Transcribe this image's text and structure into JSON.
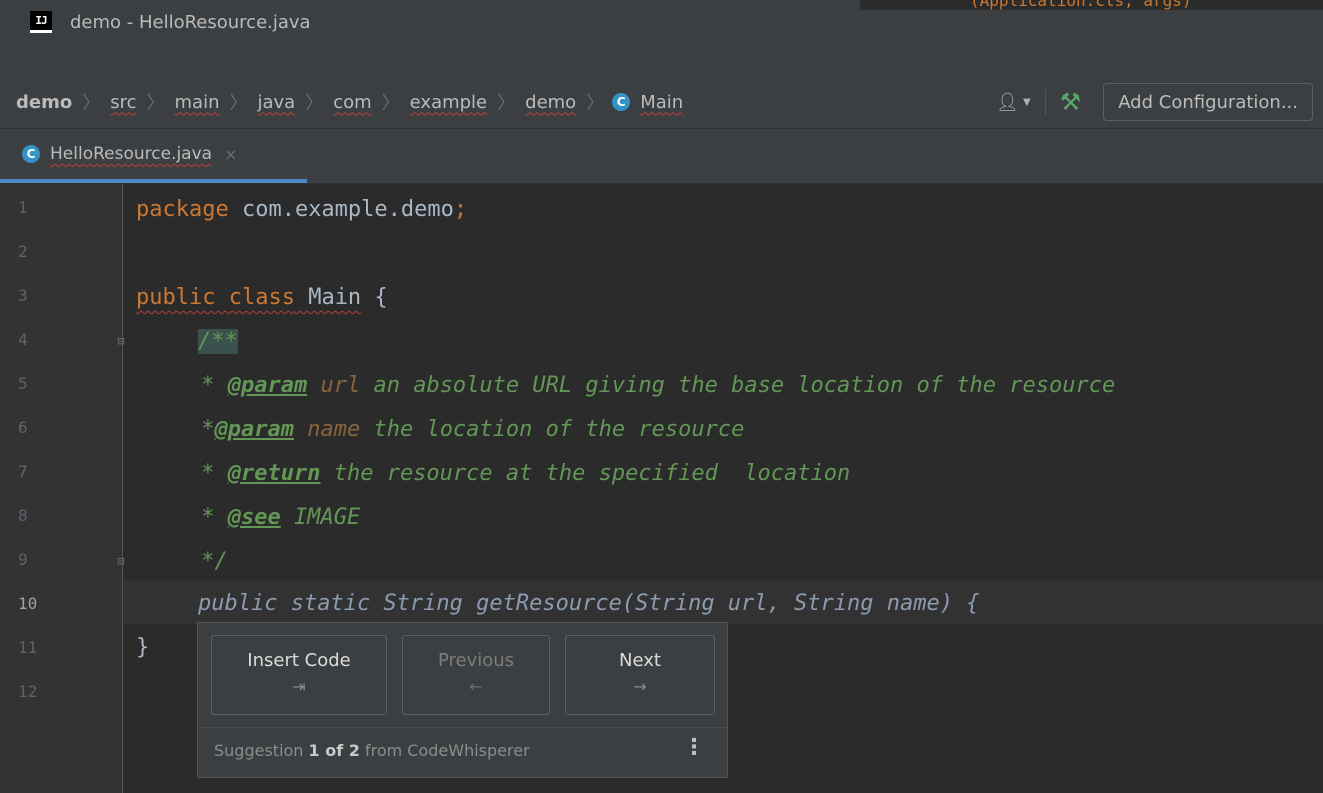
{
  "window": {
    "logo": "IJ",
    "title": "demo - HelloResource.java",
    "background_code": "(Application.cls, args)"
  },
  "navbar": {
    "breadcrumbs": [
      "demo",
      "src",
      "main",
      "java",
      "com",
      "example",
      "demo",
      "Main"
    ],
    "class_badge": "C",
    "add_config_label": "Add Configuration...",
    "user_icon": "person-icon",
    "build_icon": "hammer-icon"
  },
  "tab": {
    "badge": "C",
    "label": "HelloResource.java",
    "close": "×"
  },
  "editor": {
    "line_numbers": [
      "1",
      "2",
      "3",
      "4",
      "5",
      "6",
      "7",
      "8",
      "9",
      "10",
      "11",
      "12"
    ],
    "current_line": "10",
    "lines": {
      "l1_kw": "package",
      "l1_rest": " com.example.demo",
      "l1_semi": ";",
      "l3_kw": "public class",
      "l3_name": " Main",
      "l3_brace": " {",
      "l4": "/**",
      "l5_star": " * ",
      "l5_tag": "@param",
      "l5_name": " url",
      "l5_text": " an absolute URL giving the base location of the resource",
      "l6_star": " *",
      "l6_tag": "@param",
      "l6_name": " name",
      "l6_text": " the location of the resource",
      "l7_star": " * ",
      "l7_tag": "@return",
      "l7_text": " the resource at the specified  location",
      "l8_star": " * ",
      "l8_tag": "@see",
      "l8_text": " IMAGE",
      "l9": " */",
      "l10_ghost": "public static String getResource(String url, String name) {",
      "l11": "}"
    }
  },
  "suggestion_popup": {
    "buttons": [
      {
        "label": "Insert Code",
        "shortcut": "⇥",
        "enabled": true
      },
      {
        "label": "Previous",
        "shortcut": "←",
        "enabled": false
      },
      {
        "label": "Next",
        "shortcut": "→",
        "enabled": true
      }
    ],
    "status_prefix": "Suggestion",
    "current": "1 of 2",
    "status_suffix": "from CodeWhisperer",
    "more_icon": "⋮"
  },
  "colors": {
    "keyword": "#cc7832",
    "comment": "#629755",
    "accent": "#4a88c7",
    "error_underline": "#bc3f3c"
  }
}
